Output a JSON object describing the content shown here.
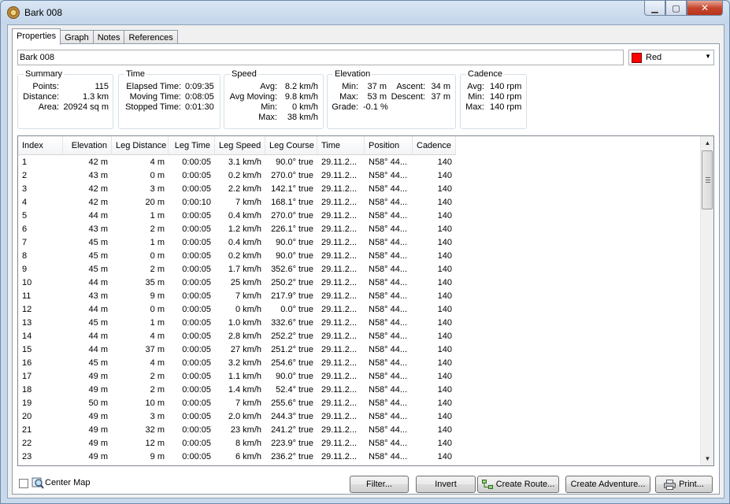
{
  "window": {
    "title": "Bark 008"
  },
  "caption": {
    "minimize": "▁",
    "maximize": "▢",
    "close": "✕"
  },
  "tabs": [
    {
      "label": "Properties"
    },
    {
      "label": "Graph"
    },
    {
      "label": "Notes"
    },
    {
      "label": "References"
    }
  ],
  "name_field": {
    "value": "Bark 008"
  },
  "color_select": {
    "value": "Red",
    "swatch_color": "#ff0000"
  },
  "summary": {
    "title": "Summary",
    "points_label": "Points:",
    "points": "115",
    "distance_label": "Distance:",
    "distance": "1.3 km",
    "area_label": "Area:",
    "area": "20924 sq m"
  },
  "time": {
    "title": "Time",
    "elapsed_label": "Elapsed Time:",
    "elapsed": "0:09:35",
    "moving_label": "Moving Time:",
    "moving": "0:08:05",
    "stopped_label": "Stopped Time:",
    "stopped": "0:01:30"
  },
  "speed": {
    "title": "Speed",
    "avg_label": "Avg:",
    "avg": "8.2 km/h",
    "avg_moving_label": "Avg Moving:",
    "avg_moving": "9.8 km/h",
    "min_label": "Min:",
    "min": "0 km/h",
    "max_label": "Max:",
    "max": "38 km/h"
  },
  "elevation": {
    "title": "Elevation",
    "min_label": "Min:",
    "min": "37 m",
    "max_label": "Max:",
    "max": "53 m",
    "grade_label": "Grade:",
    "grade": "-0.1 %",
    "ascent_label": "Ascent:",
    "ascent": "34 m",
    "descent_label": "Descent:",
    "descent": "37 m"
  },
  "cadence": {
    "title": "Cadence",
    "avg_label": "Avg:",
    "avg": "140 rpm",
    "min_label": "Min:",
    "min": "140 rpm",
    "max_label": "Max:",
    "max": "140 rpm"
  },
  "table": {
    "columns": [
      "Index",
      "Elevation",
      "Leg Distance",
      "Leg Time",
      "Leg Speed",
      "Leg Course",
      "Time",
      "Position",
      "Cadence"
    ],
    "rows": [
      [
        "1",
        "42 m",
        "4 m",
        "0:00:05",
        "3.1 km/h",
        "90.0° true",
        "29.11.2...",
        "N58° 44...",
        "140"
      ],
      [
        "2",
        "43 m",
        "0 m",
        "0:00:05",
        "0.2 km/h",
        "270.0° true",
        "29.11.2...",
        "N58° 44...",
        "140"
      ],
      [
        "3",
        "42 m",
        "3 m",
        "0:00:05",
        "2.2 km/h",
        "142.1° true",
        "29.11.2...",
        "N58° 44...",
        "140"
      ],
      [
        "4",
        "42 m",
        "20 m",
        "0:00:10",
        "7 km/h",
        "168.1° true",
        "29.11.2...",
        "N58° 44...",
        "140"
      ],
      [
        "5",
        "44 m",
        "1 m",
        "0:00:05",
        "0.4 km/h",
        "270.0° true",
        "29.11.2...",
        "N58° 44...",
        "140"
      ],
      [
        "6",
        "43 m",
        "2 m",
        "0:00:05",
        "1.2 km/h",
        "226.1° true",
        "29.11.2...",
        "N58° 44...",
        "140"
      ],
      [
        "7",
        "45 m",
        "1 m",
        "0:00:05",
        "0.4 km/h",
        "90.0° true",
        "29.11.2...",
        "N58° 44...",
        "140"
      ],
      [
        "8",
        "45 m",
        "0 m",
        "0:00:05",
        "0.2 km/h",
        "90.0° true",
        "29.11.2...",
        "N58° 44...",
        "140"
      ],
      [
        "9",
        "45 m",
        "2 m",
        "0:00:05",
        "1.7 km/h",
        "352.6° true",
        "29.11.2...",
        "N58° 44...",
        "140"
      ],
      [
        "10",
        "44 m",
        "35 m",
        "0:00:05",
        "25 km/h",
        "250.2° true",
        "29.11.2...",
        "N58° 44...",
        "140"
      ],
      [
        "11",
        "43 m",
        "9 m",
        "0:00:05",
        "7 km/h",
        "217.9° true",
        "29.11.2...",
        "N58° 44...",
        "140"
      ],
      [
        "12",
        "44 m",
        "0 m",
        "0:00:05",
        "0 km/h",
        "0.0° true",
        "29.11.2...",
        "N58° 44...",
        "140"
      ],
      [
        "13",
        "45 m",
        "1 m",
        "0:00:05",
        "1.0 km/h",
        "332.6° true",
        "29.11.2...",
        "N58° 44...",
        "140"
      ],
      [
        "14",
        "44 m",
        "4 m",
        "0:00:05",
        "2.8 km/h",
        "252.2° true",
        "29.11.2...",
        "N58° 44...",
        "140"
      ],
      [
        "15",
        "44 m",
        "37 m",
        "0:00:05",
        "27 km/h",
        "251.2° true",
        "29.11.2...",
        "N58° 44...",
        "140"
      ],
      [
        "16",
        "45 m",
        "4 m",
        "0:00:05",
        "3.2 km/h",
        "254.6° true",
        "29.11.2...",
        "N58° 44...",
        "140"
      ],
      [
        "17",
        "49 m",
        "2 m",
        "0:00:05",
        "1.1 km/h",
        "90.0° true",
        "29.11.2...",
        "N58° 44...",
        "140"
      ],
      [
        "18",
        "49 m",
        "2 m",
        "0:00:05",
        "1.4 km/h",
        "52.4° true",
        "29.11.2...",
        "N58° 44...",
        "140"
      ],
      [
        "19",
        "50 m",
        "10 m",
        "0:00:05",
        "7 km/h",
        "255.6° true",
        "29.11.2...",
        "N58° 44...",
        "140"
      ],
      [
        "20",
        "49 m",
        "3 m",
        "0:00:05",
        "2.0 km/h",
        "244.3° true",
        "29.11.2...",
        "N58° 44...",
        "140"
      ],
      [
        "21",
        "49 m",
        "32 m",
        "0:00:05",
        "23 km/h",
        "241.2° true",
        "29.11.2...",
        "N58° 44...",
        "140"
      ],
      [
        "22",
        "49 m",
        "12 m",
        "0:00:05",
        "8 km/h",
        "223.9° true",
        "29.11.2...",
        "N58° 44...",
        "140"
      ],
      [
        "23",
        "49 m",
        "9 m",
        "0:00:05",
        "6 km/h",
        "236.2° true",
        "29.11.2...",
        "N58° 44...",
        "140"
      ]
    ]
  },
  "bottom": {
    "center_map_label": "Center Map",
    "center_map_checked": false,
    "filter_label": "Filter...",
    "invert_label": "Invert",
    "create_route_label": "Create Route...",
    "create_adventure_label": "Create Adventure...",
    "print_label": "Print..."
  }
}
